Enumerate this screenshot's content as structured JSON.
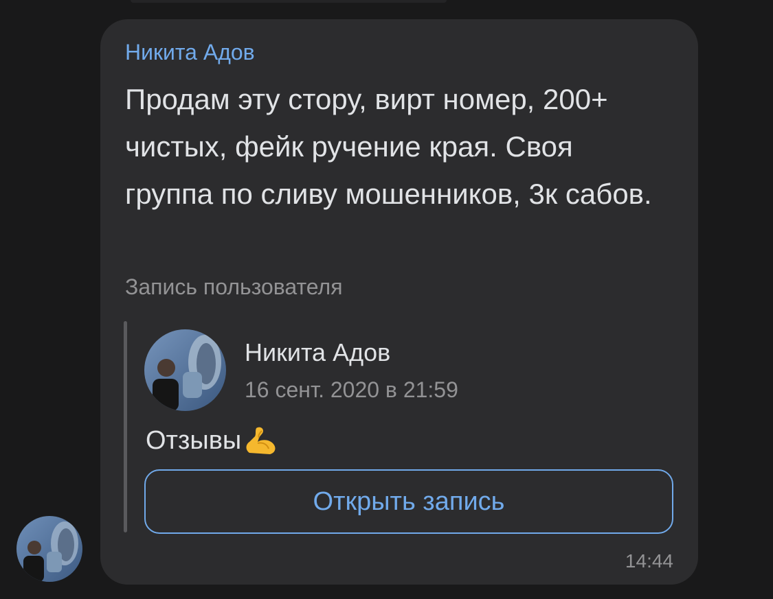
{
  "message": {
    "sender_name": "Никита Адов",
    "text": "Продам эту стору, вирт номер, 200+ чистых, фейк ручение края. Своя группа по сливу мошенников, 3к сабов.",
    "time": "14:44"
  },
  "forwarded_post": {
    "label": "Запись пользователя",
    "author": "Никита Адов",
    "date": "16 сент. 2020 в 21:59",
    "text": "Отзывы",
    "emoji": "flexed-biceps-icon",
    "open_button_label": "Открыть запись"
  },
  "colors": {
    "background": "#19191a",
    "bubble": "#2c2c2e",
    "accent": "#71aaeb",
    "primary_text": "#e1e3e6",
    "secondary_text": "#939395"
  }
}
